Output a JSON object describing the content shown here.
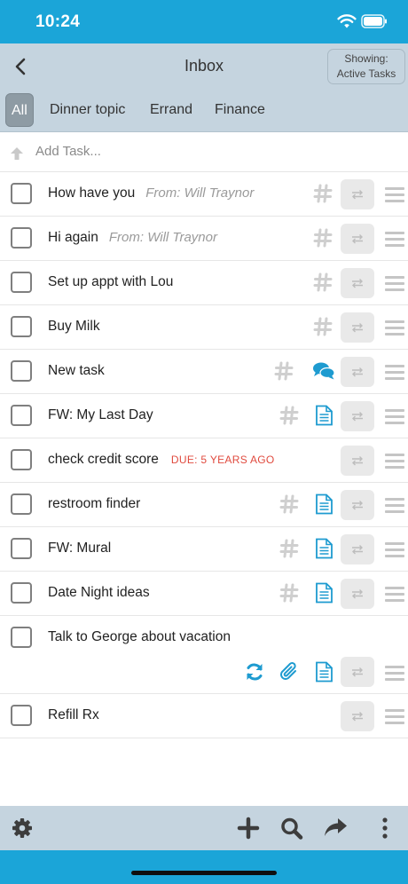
{
  "status_bar": {
    "time": "10:24"
  },
  "nav": {
    "title": "Inbox",
    "showing_line1": "Showing:",
    "showing_line2": "Active Tasks"
  },
  "filters": [
    "All",
    "Dinner topic",
    "Errand",
    "Finance"
  ],
  "add_task": {
    "placeholder": "Add Task..."
  },
  "tasks": [
    {
      "title": "How have you",
      "from": "From: Will Traynor",
      "icons": [
        "hashtag"
      ]
    },
    {
      "title": "Hi again",
      "from": "From: Will Traynor",
      "icons": [
        "hashtag"
      ]
    },
    {
      "title": "Set up appt with Lou",
      "icons": [
        "hashtag"
      ]
    },
    {
      "title": "Buy Milk",
      "icons": [
        "hashtag"
      ]
    },
    {
      "title": "New task",
      "icons": [
        "hashtag",
        "comments"
      ]
    },
    {
      "title": "FW: My Last Day",
      "icons": [
        "hashtag",
        "note"
      ]
    },
    {
      "title": "check credit score",
      "due": "DUE: 5 YEARS AGO",
      "icons": []
    },
    {
      "title": "restroom finder",
      "icons": [
        "hashtag",
        "note"
      ]
    },
    {
      "title": "FW: Mural",
      "icons": [
        "hashtag",
        "note"
      ]
    },
    {
      "title": "Date Night ideas",
      "icons": [
        "hashtag",
        "note"
      ]
    },
    {
      "title": "Talk to George about vacation",
      "icons": [
        "repeat",
        "attachment",
        "note"
      ]
    },
    {
      "title": "Refill Rx",
      "icons": []
    }
  ],
  "toolbar": {
    "icons": [
      "gear-icon",
      "plus-icon",
      "search-icon",
      "share-icon",
      "more-icon"
    ]
  },
  "colors": {
    "accent": "#1BA5D8",
    "header_bg": "#C5D4DF",
    "due_red": "#E04A3E",
    "icon_blue": "#1E9BD0",
    "icon_gray": "#cfcfcf"
  }
}
